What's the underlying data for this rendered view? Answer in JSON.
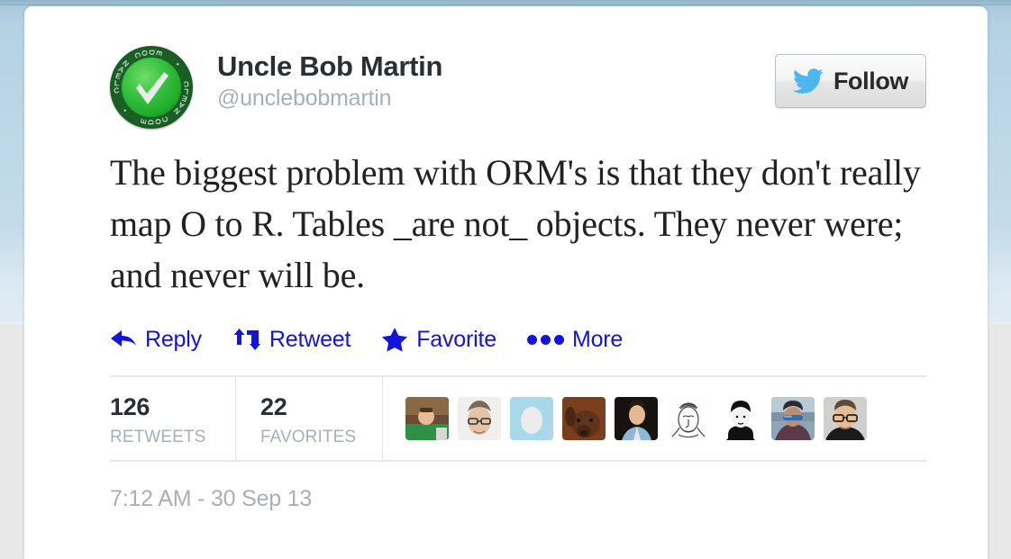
{
  "background": {
    "sky_color": "#cfe2ef",
    "ground_color": "#e8e8e8",
    "top_strip_color": "#9cc0d6"
  },
  "card": {
    "background_color": "#ffffff"
  },
  "user": {
    "display_name": "Uncle Bob Martin",
    "handle": "@unclebobmartin",
    "avatar": {
      "type": "clean-code-badge",
      "ring_text": "CLEAN CODE",
      "ring_color": "#1a5f26",
      "core_color": "#2fbb37",
      "check_color": "#f2f2f2"
    }
  },
  "follow_button": {
    "label": "Follow",
    "icon": "twitter-bird-icon",
    "icon_color": "#4cb6ef"
  },
  "tweet": {
    "text": "The biggest problem with ORM's is that they don't really map O to R. Tables _are not_ objects. They never were; and never will be.",
    "timestamp": "7:12 AM - 30 Sep 13"
  },
  "actions": [
    {
      "id": "reply",
      "label": "Reply",
      "icon": "reply-arrow-icon"
    },
    {
      "id": "retweet",
      "label": "Retweet",
      "icon": "retweet-icon"
    },
    {
      "id": "favorite",
      "label": "Favorite",
      "icon": "star-icon"
    },
    {
      "id": "more",
      "label": "More",
      "icon": "more-dots-icon"
    }
  ],
  "action_color": "#1313e0",
  "stats": {
    "retweets": {
      "count": "126",
      "label": "RETWEETS"
    },
    "favorites": {
      "count": "22",
      "label": "FAVORITES"
    }
  },
  "engaged_users": [
    {
      "id": 1,
      "alt": "person in green shirt"
    },
    {
      "id": 2,
      "alt": "man with glasses"
    },
    {
      "id": 3,
      "alt": "default egg avatar"
    },
    {
      "id": 4,
      "alt": "brown dog"
    },
    {
      "id": 5,
      "alt": "man in blue shirt"
    },
    {
      "id": 6,
      "alt": "line drawing portrait"
    },
    {
      "id": 7,
      "alt": "black and white portrait"
    },
    {
      "id": 8,
      "alt": "person with sunglasses in snow"
    },
    {
      "id": 9,
      "alt": "man with glasses dark shirt"
    }
  ]
}
